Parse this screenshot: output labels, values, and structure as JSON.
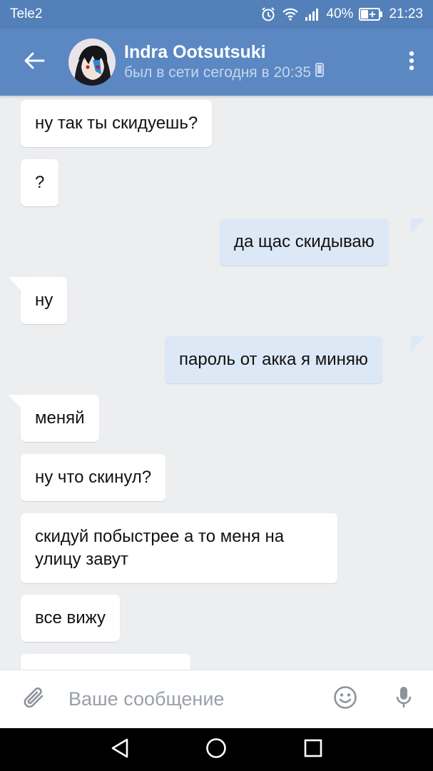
{
  "status_bar": {
    "carrier": "Tele2",
    "battery": "40%",
    "time": "21:23"
  },
  "header": {
    "name": "Indra Ootsutsuki",
    "status": "был в сети сегодня в 20:35"
  },
  "messages": [
    {
      "text": "ну так ты скидуешь?",
      "direction": "in"
    },
    {
      "text": "?",
      "direction": "in"
    },
    {
      "text": "да щас скидываю",
      "direction": "out"
    },
    {
      "text": "ну",
      "direction": "in"
    },
    {
      "text": "пароль от акка я миняю",
      "direction": "out"
    },
    {
      "text": "меняй",
      "direction": "in"
    },
    {
      "text": "ну что скинул?",
      "direction": "in"
    },
    {
      "text": "скидуй побыстрее а то меня на улицу завут",
      "direction": "in"
    },
    {
      "text": "все вижу",
      "direction": "in"
    }
  ],
  "input": {
    "placeholder": "Ваше сообщение"
  },
  "colors": {
    "header": "#5b88c3",
    "status_bar": "#5380b8",
    "background": "#edeef0",
    "outgoing_bubble": "#dde8f6",
    "incoming_bubble": "#ffffff"
  },
  "icons": {
    "back": "arrow-left",
    "menu": "more-vertical",
    "attach": "paperclip",
    "emoji": "smiley",
    "mic": "microphone",
    "device": "phone",
    "nav_back": "triangle",
    "nav_home": "circle",
    "nav_recent": "square"
  }
}
